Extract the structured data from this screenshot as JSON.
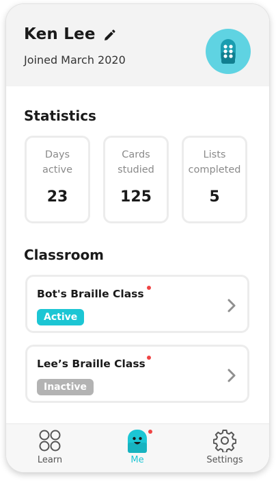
{
  "profile": {
    "name": "Ken Lee",
    "joined": "Joined March 2020",
    "avatar_color": "#5fd3e2"
  },
  "statistics": {
    "title": "Statistics",
    "cards": [
      {
        "label": "Days active",
        "value": "23"
      },
      {
        "label": "Cards studied",
        "value": "125"
      },
      {
        "label": "Lists completed",
        "value": "5"
      }
    ]
  },
  "classroom": {
    "title": "Classroom",
    "classes": [
      {
        "name": "Bot's Braille Class",
        "status": "Active",
        "has_notification": true
      },
      {
        "name": "Lee’s Braille Class",
        "status": "Inactive",
        "has_notification": true
      }
    ]
  },
  "nav": {
    "items": [
      {
        "label": "Learn",
        "icon": "grid-circles-icon",
        "active": false
      },
      {
        "label": "Me",
        "icon": "robot-face-icon",
        "active": true,
        "has_notification": true
      },
      {
        "label": "Settings",
        "icon": "gear-icon",
        "active": false
      }
    ]
  },
  "colors": {
    "accent": "#1cc6d4",
    "notification": "#ef4444",
    "inactive": "#b3b3b3"
  }
}
